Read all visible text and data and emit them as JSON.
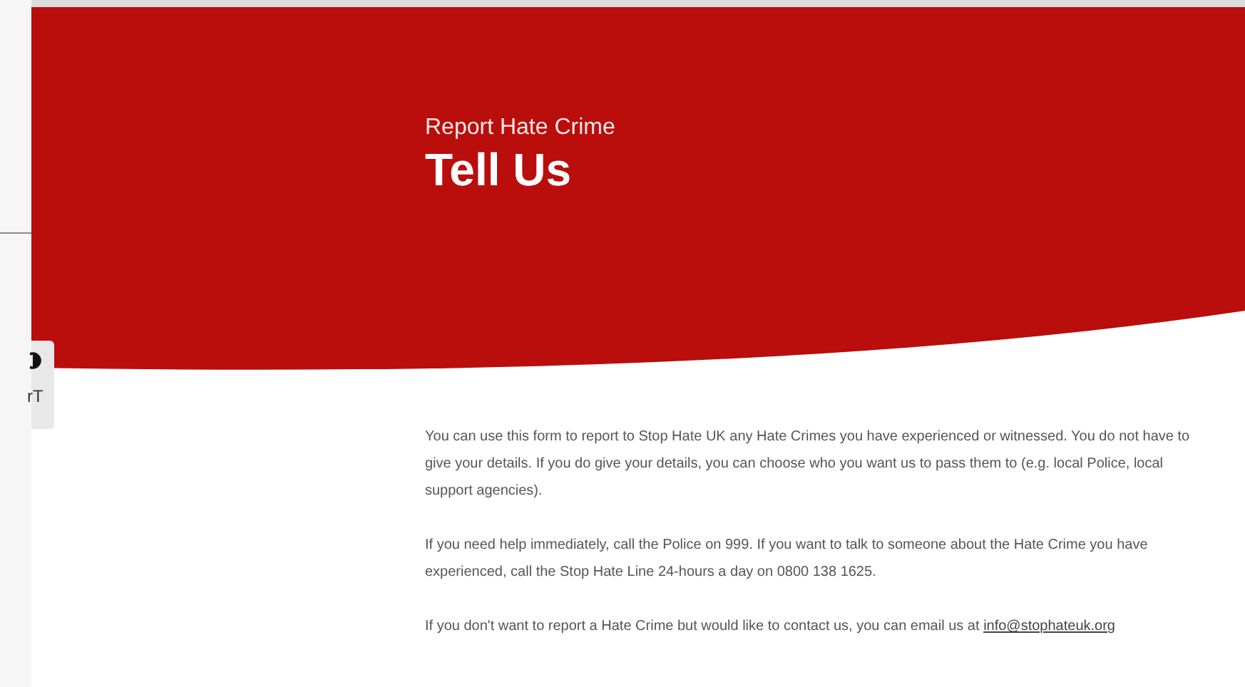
{
  "hero": {
    "eyebrow": "Report Hate Crime",
    "title": "Tell Us"
  },
  "accessibility_toolbar": {
    "text_size_label": "rT"
  },
  "paragraphs": [
    {
      "text": "You can use this form to report to Stop Hate UK any Hate Crimes you have experienced or witnessed. You do not have to give your details. If you do give your details, you can choose who you want us to pass them to (e.g. local Police, local support agencies)."
    },
    {
      "text": "If you need help immediately, call the Police on 999. If you want to talk to someone about the Hate Crime you have experienced, call the Stop Hate Line 24-hours a day on 0800 138 1625."
    },
    {
      "text": "If you don't want to report a Hate Crime but would like to contact us, you can email us at",
      "link": "info@stophateuk.org"
    }
  ]
}
